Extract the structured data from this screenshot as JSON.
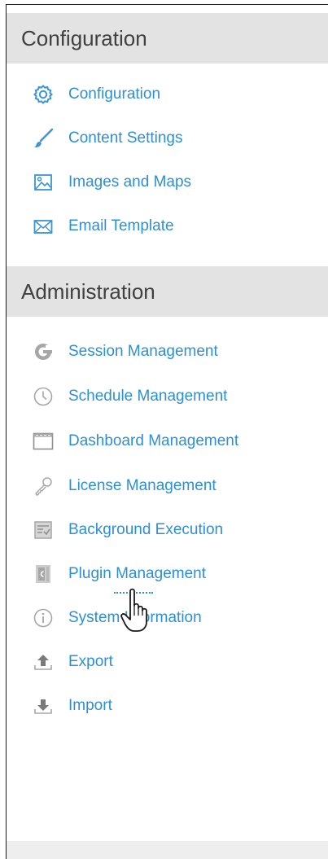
{
  "configuration": {
    "header": "Configuration",
    "items": [
      {
        "label": "Configuration",
        "icon": "gear-icon"
      },
      {
        "label": "Content Settings",
        "icon": "brush-icon"
      },
      {
        "label": "Images and Maps",
        "icon": "image-icon"
      },
      {
        "label": "Email Template",
        "icon": "envelope-icon"
      }
    ]
  },
  "administration": {
    "header": "Administration",
    "items": [
      {
        "label": "Session Management",
        "icon": "session-icon"
      },
      {
        "label": "Schedule Management",
        "icon": "clock-icon"
      },
      {
        "label": "Dashboard Management",
        "icon": "dashboard-icon"
      },
      {
        "label": "License Management",
        "icon": "key-icon"
      },
      {
        "label": "Background Execution",
        "icon": "background-execution-icon"
      },
      {
        "label": "Plugin Management",
        "icon": "plugin-icon"
      },
      {
        "label": "System Information",
        "icon": "info-icon"
      },
      {
        "label": "Export",
        "icon": "export-icon"
      },
      {
        "label": "Import",
        "icon": "import-icon"
      }
    ]
  },
  "colors": {
    "link": "#2e8fd3",
    "header_bg": "#e3e3e3",
    "header_text": "#404040",
    "config_icon": "#3a94d6",
    "admin_icon": "#a6a6a6"
  }
}
